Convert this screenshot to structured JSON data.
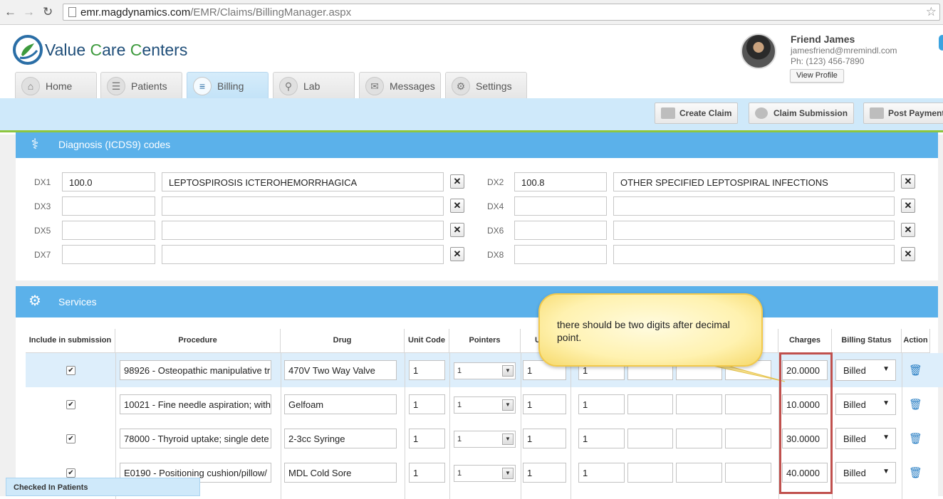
{
  "browser": {
    "url_domain": "emr.magdynamics.com",
    "url_path": "/EMR/Claims/BillingManager.aspx"
  },
  "app": {
    "logo_part1": "Value ",
    "logo_part2": "C",
    "logo_part3": "are ",
    "logo_part4": "C",
    "logo_part5": "enters"
  },
  "user": {
    "name": "Friend James",
    "email": "jamesfriend@mremindl.com",
    "phone": "Ph: (123) 456-7890",
    "view_profile": "View Profile"
  },
  "tabs": [
    {
      "label": "Home",
      "icon": "home-icon"
    },
    {
      "label": "Patients",
      "icon": "bed-icon"
    },
    {
      "label": "Billing",
      "icon": "list-icon",
      "active": true
    },
    {
      "label": "Lab",
      "icon": "flask-icon"
    },
    {
      "label": "Messages",
      "icon": "message-icon"
    },
    {
      "label": "Settings",
      "icon": "gear-icon"
    }
  ],
  "toolbar": {
    "create_claim": "Create Claim",
    "claim_submission": "Claim Submission",
    "post_payment": "Post Payment"
  },
  "diagnosis": {
    "title": "Diagnosis (ICDS9) codes",
    "rows": [
      {
        "label": "DX1",
        "code": "100.0",
        "desc": "LEPTOSPIROSIS ICTEROHEMORRHAGICA"
      },
      {
        "label": "DX2",
        "code": "100.8",
        "desc": "OTHER SPECIFIED LEPTOSPIRAL INFECTIONS"
      },
      {
        "label": "DX3",
        "code": "",
        "desc": ""
      },
      {
        "label": "DX4",
        "code": "",
        "desc": ""
      },
      {
        "label": "DX5",
        "code": "",
        "desc": ""
      },
      {
        "label": "DX6",
        "code": "",
        "desc": ""
      },
      {
        "label": "DX7",
        "code": "",
        "desc": ""
      },
      {
        "label": "DX8",
        "code": "",
        "desc": ""
      }
    ],
    "remove_glyph": "✕"
  },
  "services": {
    "title": "Services",
    "headers": {
      "include": "Include in submission",
      "procedure": "Procedure",
      "drug": "Drug",
      "unit_code": "Unit Code",
      "pointers": "Pointers",
      "units_partial": "U",
      "charges": "Charges",
      "billing_status": "Billing Status",
      "action": "Action"
    },
    "rows": [
      {
        "checked": "✔",
        "procedure": "98926 - Osteopathic manipulative tr",
        "drug": "470V Two Way Valve",
        "unit_code": "1",
        "pointer": "1",
        "units": "1",
        "dx_ptr": "1",
        "charges": "20.0000",
        "status": "Billed"
      },
      {
        "checked": "✔",
        "procedure": "10021 - Fine needle aspiration; with",
        "drug": "Gelfoam",
        "unit_code": "1",
        "pointer": "1",
        "units": "1",
        "dx_ptr": "1",
        "charges": "10.0000",
        "status": "Billed"
      },
      {
        "checked": "✔",
        "procedure": "78000 - Thyroid uptake; single dete",
        "drug": "2-3cc Syringe",
        "unit_code": "1",
        "pointer": "1",
        "units": "1",
        "dx_ptr": "1",
        "charges": "30.0000",
        "status": "Billed"
      },
      {
        "checked": "✔",
        "procedure": "E0190 - Positioning cushion/pillow/",
        "drug": "MDL Cold Sore",
        "unit_code": "1",
        "pointer": "1",
        "units": "1",
        "dx_ptr": "1",
        "charges": "40.0000",
        "status": "Billed"
      }
    ]
  },
  "annotation": {
    "text": "there should be two digits after decimal point."
  },
  "footer": {
    "checked_in": "Checked In Patients"
  },
  "colors": {
    "panel_header": "#5bb1ea",
    "toolbar": "#cfe9fa",
    "accent_green": "#8dc63f",
    "highlight_red": "#c0504d"
  }
}
